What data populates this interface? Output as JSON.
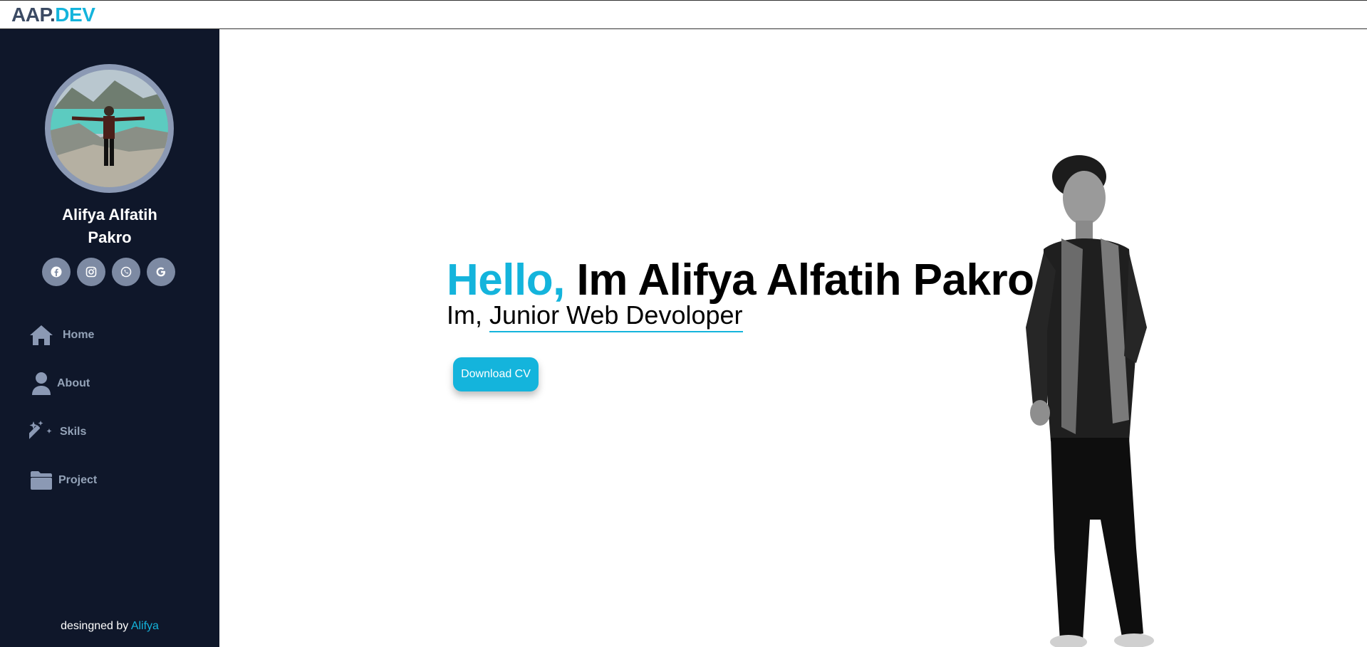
{
  "logo": {
    "part1": "AAP.",
    "part2": "DEV"
  },
  "profile": {
    "name": "Alifya Alfatih Pakro",
    "avatar_alt": "Profile photo"
  },
  "socials": [
    {
      "icon": "facebook-icon"
    },
    {
      "icon": "instagram-icon"
    },
    {
      "icon": "whatsapp-icon"
    },
    {
      "icon": "google-icon"
    }
  ],
  "nav": [
    {
      "label": "Home",
      "icon": "home-icon"
    },
    {
      "label": "About",
      "icon": "user-icon"
    },
    {
      "label": "Skils",
      "icon": "magic-wand-icon"
    },
    {
      "label": "Project",
      "icon": "folder-icon"
    }
  ],
  "footer": {
    "prefix": "desingned by ",
    "author": "Alifya"
  },
  "hero": {
    "hello": "Hello,",
    "title_rest": " Im Alifya Alfatih Pakro",
    "sub_prefix": "Im, ",
    "role": "Junior Web Devoloper",
    "cv_button": "Download CV"
  },
  "colors": {
    "accent": "#14b4dc",
    "sidebar_bg": "#0f172a",
    "nav_text": "#94a3b8",
    "social_bg": "#7d8aa3"
  }
}
